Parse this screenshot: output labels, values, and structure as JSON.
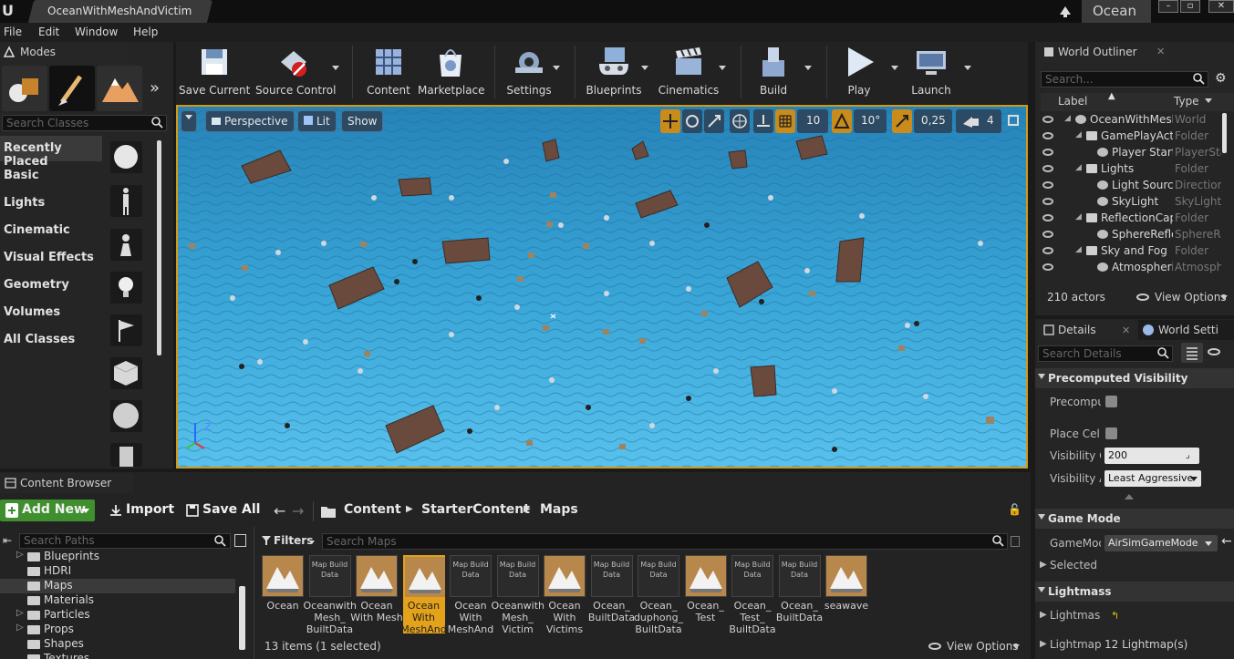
{
  "titlebar": {
    "doc_tab": "OceanWithMeshAndVictim",
    "project": "Ocean",
    "logo": "U"
  },
  "menu": [
    "File",
    "Edit",
    "Window",
    "Help"
  ],
  "modes": {
    "tab": "Modes",
    "search_placeholder": "Search Classes",
    "categories": [
      "Recently Placed",
      "Basic",
      "Lights",
      "Cinematic",
      "Visual Effects",
      "Geometry",
      "Volumes",
      "All Classes"
    ],
    "selected_category": "Recently Placed"
  },
  "toolbar": {
    "items": [
      {
        "label": "Save Current",
        "icon": "save-icon"
      },
      {
        "label": "Source Control",
        "icon": "source-control-icon"
      },
      {
        "label": "Content",
        "icon": "content-icon"
      },
      {
        "label": "Marketplace",
        "icon": "marketplace-icon"
      },
      {
        "label": "Settings",
        "icon": "settings-icon"
      },
      {
        "label": "Blueprints",
        "icon": "blueprints-icon"
      },
      {
        "label": "Cinematics",
        "icon": "cinematics-icon"
      },
      {
        "label": "Build",
        "icon": "build-icon"
      },
      {
        "label": "Play",
        "icon": "play-icon"
      },
      {
        "label": "Launch",
        "icon": "launch-icon"
      }
    ]
  },
  "viewport": {
    "perspective": "Perspective",
    "lit": "Lit",
    "show": "Show",
    "grid_snap": "10",
    "rotation_snap": "10°",
    "scale_snap": "0,25",
    "camera_speed": "4",
    "axis_z": "Z"
  },
  "outliner": {
    "tab": "World Outliner",
    "search_placeholder": "Search...",
    "col_label": "Label",
    "col_type": "Type",
    "rows": [
      {
        "label": "OceanWithMesh",
        "type": "World",
        "indent": 0
      },
      {
        "label": "GamePlayActi",
        "type": "Folder",
        "indent": 1
      },
      {
        "label": "Player Start",
        "type": "PlayerSta",
        "indent": 2
      },
      {
        "label": "Lights",
        "type": "Folder",
        "indent": 1
      },
      {
        "label": "Light Sourc",
        "type": "Directiona",
        "indent": 2
      },
      {
        "label": "SkyLight",
        "type": "SkyLight",
        "indent": 2
      },
      {
        "label": "ReflectionCap",
        "type": "Folder",
        "indent": 1
      },
      {
        "label": "SphereRefle",
        "type": "SphereRe",
        "indent": 2
      },
      {
        "label": "Sky and Fog",
        "type": "Folder",
        "indent": 1
      },
      {
        "label": "Atmospheri",
        "type": "Atmosphe",
        "indent": 2
      }
    ],
    "actor_count": "210 actors",
    "view_options": "View Options"
  },
  "details": {
    "tab": "Details",
    "tab2": "World Setti",
    "search_placeholder": "Search Details",
    "sections": {
      "precomputed": "Precomputed Visibility",
      "game_mode": "Game Mode",
      "lightmass": "Lightmass"
    },
    "fields": {
      "precomputed": "Precomput",
      "place_cells": "Place Cells",
      "visibility_cell": "Visibility Ce",
      "visibility_cell_value": "200",
      "visibility_agg": "Visibility Ag",
      "visibility_agg_value": "Least Aggressive",
      "game_mode": "GameMode",
      "game_mode_value": "AirSimGameMode",
      "selected_g": "Selected G",
      "lightmass": "Lightmass",
      "lightmaps": "Lightmaps",
      "lightmaps_value": "12 Lightmap(s)"
    }
  },
  "content_browser": {
    "tab": "Content Browser",
    "add_new": "Add New",
    "import": "Import",
    "save_all": "Save All",
    "breadcrumb": [
      "Content",
      "StarterContent",
      "Maps"
    ],
    "path_search_placeholder": "Search Paths",
    "filters": "Filters",
    "map_search_placeholder": "Search Maps",
    "tree": [
      {
        "name": "Blueprints",
        "expandable": true,
        "selected": false
      },
      {
        "name": "HDRI",
        "expandable": false,
        "selected": false
      },
      {
        "name": "Maps",
        "expandable": false,
        "selected": true
      },
      {
        "name": "Materials",
        "expandable": false,
        "selected": false
      },
      {
        "name": "Particles",
        "expandable": true,
        "selected": false
      },
      {
        "name": "Props",
        "expandable": true,
        "selected": false
      },
      {
        "name": "Shapes",
        "expandable": false,
        "selected": false
      },
      {
        "name": "Textures",
        "expandable": false,
        "selected": false
      }
    ],
    "assets": [
      {
        "name": "Ocean",
        "kind": "map",
        "selected": false
      },
      {
        "name": "Oceanwith Mesh_ BuiltData",
        "kind": "builtdata",
        "selected": false
      },
      {
        "name": "Ocean With Mesh",
        "kind": "map",
        "selected": false
      },
      {
        "name": "Ocean With MeshAnd",
        "kind": "map",
        "selected": true
      },
      {
        "name": "Ocean With MeshAnd",
        "kind": "builtdata",
        "selected": false
      },
      {
        "name": "Oceanwith Mesh_ Victim",
        "kind": "builtdata",
        "selected": false
      },
      {
        "name": "Ocean With Victims",
        "kind": "map",
        "selected": false
      },
      {
        "name": "Ocean_ BuiltData",
        "kind": "builtdata",
        "selected": false
      },
      {
        "name": "Ocean_ duphong_ BuiltData",
        "kind": "builtdata",
        "selected": false
      },
      {
        "name": "Ocean_ Test",
        "kind": "map",
        "selected": false
      },
      {
        "name": "Ocean_ Test_ BuiltData",
        "kind": "builtdata",
        "selected": false
      },
      {
        "name": "Ocean_ BuiltData",
        "kind": "builtdata",
        "selected": false
      },
      {
        "name": "seawave",
        "kind": "map",
        "selected": false
      }
    ],
    "map_build_data_label": "Map Build Data",
    "item_count": "13 items (1 selected)",
    "view_options": "View Options"
  },
  "colors": {
    "accent": "#d39b14",
    "add_new": "#3f8f2e",
    "viewport_button": "#2d4a62",
    "ocean": "#2a8fc4"
  }
}
